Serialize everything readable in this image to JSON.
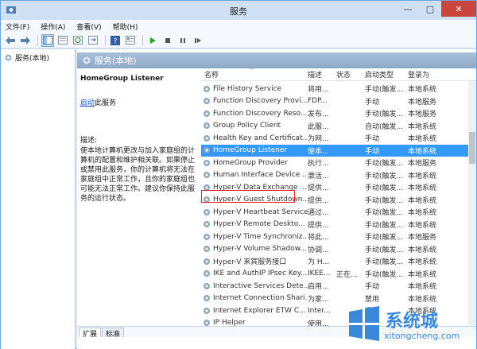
{
  "window": {
    "title": "服务"
  },
  "menu": [
    "文件(F)",
    "操作(A)",
    "查看(V)",
    "帮助(H)"
  ],
  "left_tree": {
    "label": "服务(本地)"
  },
  "pane": {
    "header": "服务(本地)"
  },
  "details": {
    "title": "HomeGroup Listener",
    "action_link": "启动",
    "action_suffix": "此服务",
    "desc_label": "描述:",
    "desc_text": "使本地计算机更改与加入家庭组的计算机的配置和维护相关联。如果停止或禁用此服务，你的计算机将无法在家庭组中正常工作，且你的家庭组也可能无法正常工作。建议你保持此服务的运行状态。"
  },
  "columns": {
    "name": "名称",
    "desc": "描述",
    "status": "状态",
    "start": "启动类型",
    "logon": "登录为"
  },
  "services": [
    {
      "name": "File History Service",
      "desc": "将用...",
      "status": "",
      "start": "手动(触发...",
      "logon": "本地系统"
    },
    {
      "name": "Function Discovery Provi...",
      "desc": "FDP...",
      "status": "",
      "start": "手动",
      "logon": "本地服务"
    },
    {
      "name": "Function Discovery Reso...",
      "desc": "发布...",
      "status": "",
      "start": "手动(触发...",
      "logon": "本地服务"
    },
    {
      "name": "Group Policy Client",
      "desc": "此服...",
      "status": "",
      "start": "自动(触发...",
      "logon": "本地系统"
    },
    {
      "name": "Health Key and Certificat...",
      "desc": "为网...",
      "status": "",
      "start": "手动",
      "logon": "本地系统"
    },
    {
      "name": "HomeGroup Listener",
      "desc": "使本...",
      "status": "",
      "start": "手动",
      "logon": "本地系统"
    },
    {
      "name": "HomeGroup Provider",
      "desc": "执行...",
      "status": "",
      "start": "手动(触发...",
      "logon": "本地服务"
    },
    {
      "name": "Human Interface Device ...",
      "desc": "激活...",
      "status": "",
      "start": "手动(触发...",
      "logon": "本地系统"
    },
    {
      "name": "Hyper-V Data Exchange ...",
      "desc": "提供...",
      "status": "",
      "start": "手动(触发...",
      "logon": "本地系统"
    },
    {
      "name": "Hyper-V Guest Shutdown...",
      "desc": "提供...",
      "status": "",
      "start": "手动(触发...",
      "logon": "本地系统"
    },
    {
      "name": "Hyper-V Heartbeat Service",
      "desc": "通过...",
      "status": "",
      "start": "手动(触发...",
      "logon": "本地系统"
    },
    {
      "name": "Hyper-V Remote Deskto...",
      "desc": "提供...",
      "status": "",
      "start": "手动(触发...",
      "logon": "本地系统"
    },
    {
      "name": "Hyper-V Time Synchroniz...",
      "desc": "将此...",
      "status": "",
      "start": "手动(触发...",
      "logon": "本地服务"
    },
    {
      "name": "Hyper-V Volume Shadow...",
      "desc": "协调...",
      "status": "",
      "start": "手动(触发...",
      "logon": "本地系统"
    },
    {
      "name": "Hyper-V 来宾服务接口",
      "desc": "为 H...",
      "status": "",
      "start": "手动(触发...",
      "logon": "本地系统"
    },
    {
      "name": "IKE and AuthIP IPsec Key...",
      "desc": "IKEE...",
      "status": "正在...",
      "start": "手动(触发...",
      "logon": "本地系统"
    },
    {
      "name": "Interactive Services Dete...",
      "desc": "启用...",
      "status": "",
      "start": "手动",
      "logon": "本地系统"
    },
    {
      "name": "Internet Connection Shari...",
      "desc": "为家...",
      "status": "",
      "start": "禁用",
      "logon": "本地系统"
    },
    {
      "name": "Internet Explorer ETW C...",
      "desc": "Inter...",
      "status": "",
      "start": "手动",
      "logon": "本地系统"
    },
    {
      "name": "IP Helper",
      "desc": "使用...",
      "status": "",
      "start": "",
      "logon": ""
    }
  ],
  "selected_index": 5,
  "tabs": [
    "扩展",
    "标准"
  ],
  "watermark": {
    "text": "系统城",
    "sub": "xitongcheng.com"
  },
  "colors": {
    "selection": "#3399ff",
    "highlight": "#e02020",
    "header": "#8ea9c7",
    "link": "#1a56b8"
  }
}
